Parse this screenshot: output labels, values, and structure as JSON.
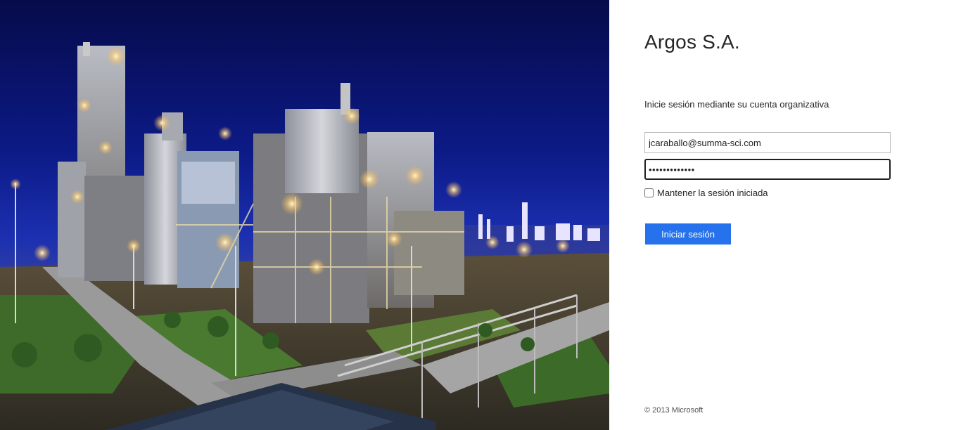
{
  "illustration": {
    "description_icon": "industrial-plant-night-image"
  },
  "login": {
    "org_name": "Argos S.A.",
    "intro": "Inicie sesión mediante su cuenta organizativa",
    "username_value": "jcaraballo@summa-sci.com",
    "password_value": "•••••••••••••",
    "keep_signed_in_label": "Mantener la sesión iniciada",
    "keep_signed_in_checked": false,
    "signin_label": "Iniciar sesión"
  },
  "footer": {
    "copyright": "© 2013 Microsoft"
  },
  "colors": {
    "accent": "#2672ec",
    "text": "#262626"
  }
}
